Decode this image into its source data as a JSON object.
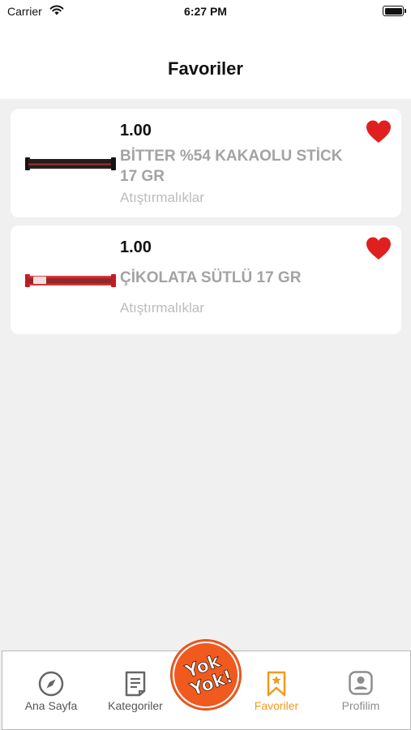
{
  "status_bar": {
    "carrier": "Carrier",
    "time": "6:27 PM"
  },
  "header": {
    "title": "Favoriler"
  },
  "favorites": [
    {
      "price": "1.00",
      "name": "BİTTER %54 KAKAOLU STİCK 17 GR",
      "category": "Atıştırmalıklar",
      "image": "dark-chocolate-stick",
      "favorited": true
    },
    {
      "price": "1.00",
      "name": "ÇİKOLATA SÜTLÜ 17 GR",
      "category": "Atıştırmalıklar",
      "image": "milk-chocolate-stick",
      "favorited": true
    }
  ],
  "tab_bar": {
    "tabs": [
      {
        "label": "Ana Sayfa",
        "icon": "compass-icon"
      },
      {
        "label": "Kategoriler",
        "icon": "document-icon"
      },
      {
        "label": "Favoriler",
        "icon": "bookmark-star-icon",
        "active": true
      },
      {
        "label": "Profilim",
        "icon": "profile-icon"
      }
    ],
    "center_logo": {
      "text": "Yok Yok!",
      "icon": "yokyok-logo"
    }
  },
  "colors": {
    "accent": "#f39a19",
    "heart": "#e02020",
    "logo": "#f05a1f",
    "background": "#f0f0f0"
  }
}
